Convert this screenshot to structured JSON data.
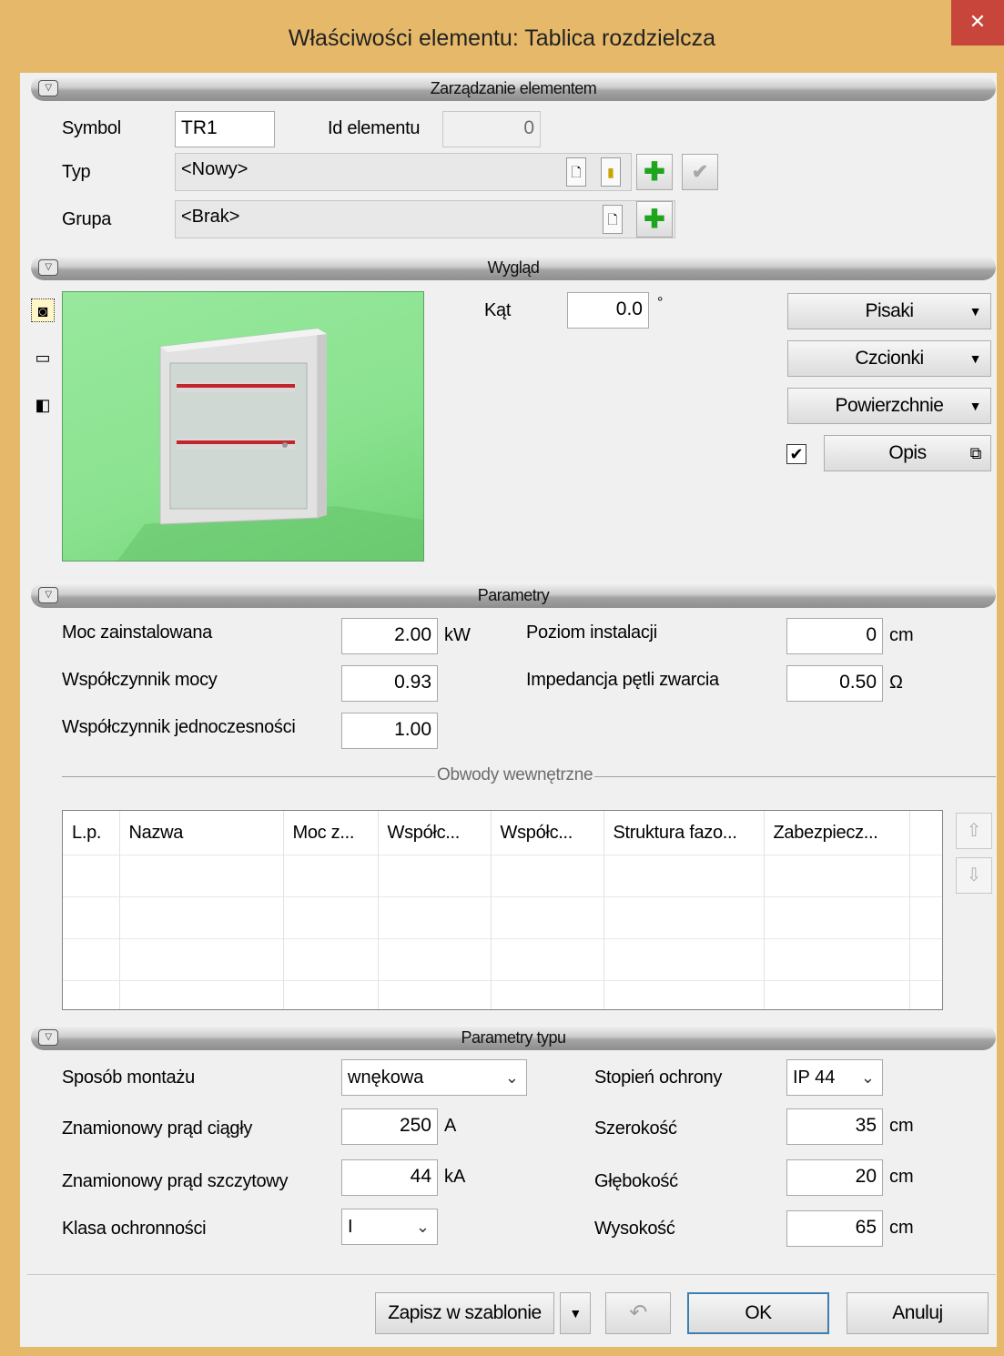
{
  "window": {
    "title": "Właściwości elementu: Tablica rozdzielcza",
    "close_glyph": "✕"
  },
  "sections": {
    "management": "Zarządzanie elementem",
    "appearance": "Wygląd",
    "parameters": "Parametry",
    "type_parameters": "Parametry typu"
  },
  "management": {
    "symbol_label": "Symbol",
    "symbol_value": "TR1",
    "id_label": "Id elementu",
    "id_value": "0",
    "type_label": "Typ",
    "type_value": "<Nowy>",
    "group_label": "Grupa",
    "group_value": "<Brak>"
  },
  "appearance": {
    "angle_label": "Kąt",
    "angle_value": "0.0",
    "angle_unit": "°",
    "pens_label": "Pisaki",
    "fonts_label": "Czcionki",
    "surfaces_label": "Powierzchnie",
    "description_label": "Opis",
    "description_checked": true,
    "views": [
      "camera-icon",
      "plan-view-icon",
      "3d-box-icon"
    ]
  },
  "parameters": {
    "installed_power_label": "Moc zainstalowana",
    "installed_power": "2.00",
    "installed_power_unit": "kW",
    "power_factor_label": "Współczynnik mocy",
    "power_factor": "0.93",
    "simultaneity_label": "Współczynnik jednoczesności",
    "simultaneity": "1.00",
    "install_level_label": "Poziom instalacji",
    "install_level": "0",
    "install_level_unit": "cm",
    "loop_impedance_label": "Impedancja pętli zwarcia",
    "loop_impedance": "0.50",
    "loop_impedance_unit": "Ω"
  },
  "circuits": {
    "title": "Obwody wewnętrzne",
    "columns": [
      "L.p.",
      "Nazwa",
      "Moc z...",
      "Współc...",
      "Współc...",
      "Struktura fazo...",
      "Zabezpiecz..."
    ],
    "rows": 4
  },
  "type_params": {
    "mount_label": "Sposób montażu",
    "mount_value": "wnękowa",
    "rated_current_label": "Znamionowy prąd ciągły",
    "rated_current": "250",
    "rated_current_unit": "A",
    "peak_current_label": "Znamionowy prąd szczytowy",
    "peak_current": "44",
    "peak_current_unit": "kA",
    "protection_class_label": "Klasa ochronności",
    "protection_class": "I",
    "ip_label": "Stopień ochrony",
    "ip_value": "IP 44",
    "width_label": "Szerokość",
    "width": "35",
    "width_unit": "cm",
    "depth_label": "Głębokość",
    "depth": "20",
    "depth_unit": "cm",
    "height_label": "Wysokość",
    "height": "65",
    "height_unit": "cm"
  },
  "footer": {
    "save_template": "Zapisz w szablonie",
    "ok": "OK",
    "cancel": "Anuluj"
  }
}
